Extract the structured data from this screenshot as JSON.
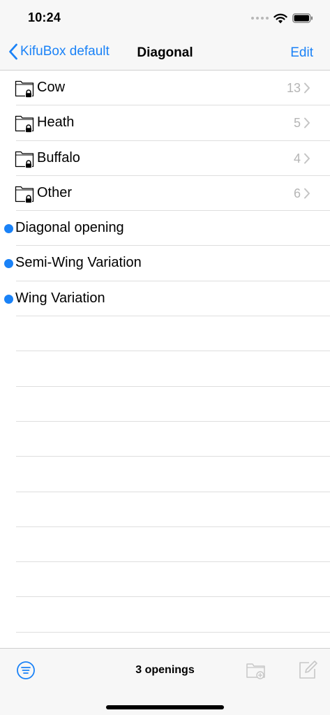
{
  "status_bar": {
    "time": "10:24"
  },
  "nav": {
    "back_label": "KifuBox default",
    "title": "Diagonal",
    "edit_label": "Edit"
  },
  "folders": [
    {
      "name": "Cow",
      "count": "13"
    },
    {
      "name": "Heath",
      "count": "5"
    },
    {
      "name": "Buffalo",
      "count": "4"
    },
    {
      "name": "Other",
      "count": "6"
    }
  ],
  "openings": [
    {
      "name": "Diagonal opening"
    },
    {
      "name": "Semi-Wing Variation"
    },
    {
      "name": "Wing Variation"
    }
  ],
  "toolbar": {
    "status": "3 openings"
  },
  "colors": {
    "accent": "#1a82f7",
    "secondary_text": "#b5b5b5",
    "separator": "#dedede",
    "bar_background": "#f7f7f7",
    "disabled_icon": "#c7c7c7"
  },
  "icons": {
    "folder": "locked-folder-icon",
    "disclosure": "chevron-right-icon",
    "filter": "filter-icon",
    "new_folder": "new-folder-icon",
    "compose": "compose-icon",
    "back": "chevron-left-icon"
  }
}
